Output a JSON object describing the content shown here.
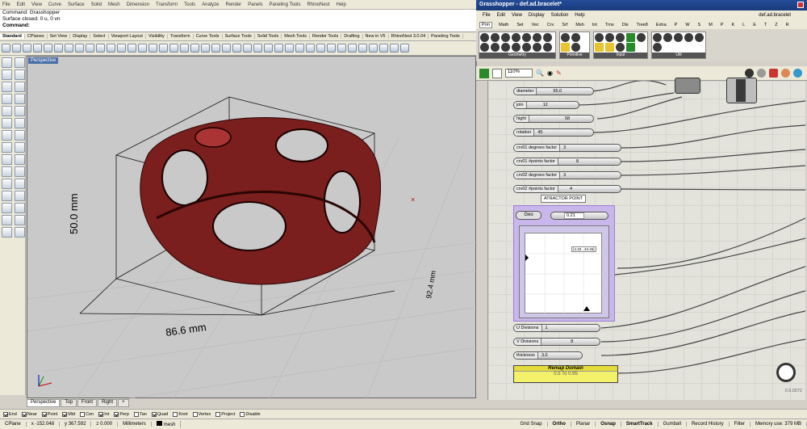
{
  "rhino": {
    "menu": [
      "File",
      "Edit",
      "View",
      "Curve",
      "Surface",
      "Solid",
      "Mesh",
      "Dimension",
      "Transform",
      "Tools",
      "Analyze",
      "Render",
      "Panels",
      "Paneling Tools",
      "RhinoNest",
      "Help"
    ],
    "command_history": [
      "Command: Grasshopper",
      "Surface closed: 0 u, 0 vn",
      "Command:"
    ],
    "toolbar_tabs": [
      "Standard",
      "CPlanes",
      "Set View",
      "Display",
      "Select",
      "Viewport Layout",
      "Visibility",
      "Transform",
      "Curve Tools",
      "Surface Tools",
      "Solid Tools",
      "Mesh Tools",
      "Render Tools",
      "Drafting",
      "New in V5",
      "RhinoNest 3.0.04",
      "Paneling Tools"
    ],
    "active_tab": "Standard",
    "viewport_title": "Perspective",
    "dimensions": {
      "height": "50.0 mm",
      "width": "86.6 mm",
      "depth": "92.4 mm"
    },
    "viewport_tabs": [
      "Perspective",
      "Top",
      "Front",
      "Right",
      "+"
    ],
    "osnaps": [
      {
        "label": "End",
        "on": true
      },
      {
        "label": "Near",
        "on": true
      },
      {
        "label": "Point",
        "on": true
      },
      {
        "label": "Mid",
        "on": true
      },
      {
        "label": "Cen",
        "on": false
      },
      {
        "label": "Int",
        "on": true
      },
      {
        "label": "Perp",
        "on": true
      },
      {
        "label": "Tan",
        "on": false
      },
      {
        "label": "Quad",
        "on": true
      },
      {
        "label": "Knot",
        "on": false
      },
      {
        "label": "Vertex",
        "on": false
      },
      {
        "label": "Project",
        "on": false
      },
      {
        "label": "Disable",
        "on": false
      }
    ],
    "status": {
      "cplane": "CPlane",
      "x": "x -152.048",
      "y": "y 367.592",
      "z": "z 0.000",
      "units": "Millimeters",
      "layer": "mesh",
      "grid_snap": "Grid Snap",
      "ortho": "Ortho",
      "planar": "Planar",
      "osnap": "Osnap",
      "smarttrack": "SmartTrack",
      "gumball": "Gumball",
      "record_history": "Record History",
      "filter": "Filter",
      "memory": "Memory use: 379 MB"
    }
  },
  "grasshopper": {
    "title": "Grasshopper - def.ad.bracelet*",
    "doc_name": "def.ad.bracelet",
    "menu": [
      "File",
      "Edit",
      "View",
      "Display",
      "Solution",
      "Help"
    ],
    "tabs": [
      "Prm",
      "Math",
      "Set",
      "Vec",
      "Crv",
      "Srf",
      "Msh",
      "Int",
      "Trns",
      "Dis",
      "Tree8",
      "Extra",
      "P",
      "W",
      "S",
      "M",
      "P",
      "K",
      "L",
      "E",
      "T",
      "Z",
      "R"
    ],
    "active_tab": "Prm",
    "panel_groups": [
      "Geometry",
      "Primitive",
      "Input",
      "Util"
    ],
    "zoom": "110%",
    "sliders": [
      {
        "label": "diameter",
        "value": "95.0"
      },
      {
        "label": "join",
        "value": "12"
      },
      {
        "label": "hight",
        "value": "58"
      },
      {
        "label": "rotation",
        "value": "45"
      },
      {
        "label": "crv01 degrees factor",
        "value": "3"
      },
      {
        "label": "crv01 #points factor",
        "value": "8"
      },
      {
        "label": "crv02 degrees factor",
        "value": "3"
      },
      {
        "label": "crv02 #points factor",
        "value": "4"
      },
      {
        "label": "U Divisions",
        "value": "1"
      },
      {
        "label": "V Divisions",
        "value": "8"
      },
      {
        "label": "thickness",
        "value": "3.0"
      }
    ],
    "group_label": "ATRACTOR POINT",
    "geo_label": "Geo",
    "geo_value": "0.21",
    "graph_readout": "{4.33 , 43.45}",
    "remap_title": "Remap Domain",
    "remap_value": "0.5 To 0.95",
    "status": "0.9.0072"
  }
}
